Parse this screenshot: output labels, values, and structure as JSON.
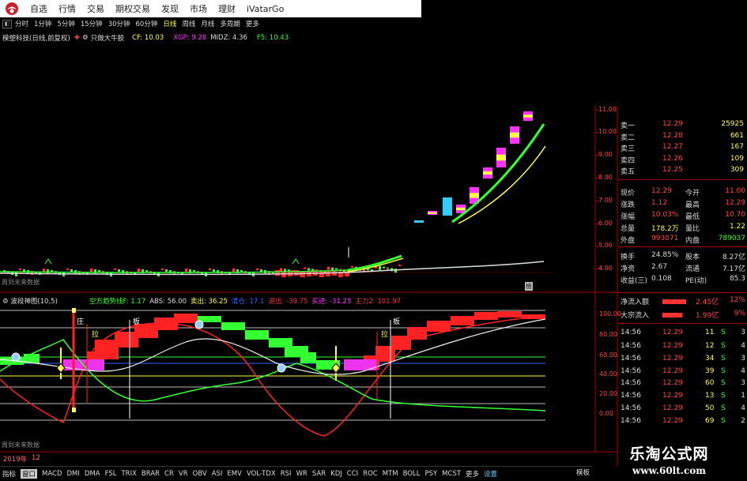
{
  "menu": {
    "items": [
      "自选",
      "行情",
      "交易",
      "期权交易",
      "发现",
      "市场",
      "理财",
      "iVatarGo"
    ]
  },
  "periods": {
    "items": [
      "分时",
      "1分钟",
      "5分钟",
      "15分钟",
      "30分钟",
      "60分钟",
      "日线",
      "周线",
      "月线",
      "多周期",
      "更多"
    ],
    "active": 6
  },
  "info": {
    "stock": "模塑科技(日线,前复权)",
    "tag": "只做大牛股",
    "cf": "CF: 10.03",
    "xgp": "XGP: 9.28",
    "midz": "MIDZ: 4.36",
    "f5": "F5: 10.43"
  },
  "main_chart": {
    "y_ticks": [
      "11.00",
      "10.00",
      "9.00",
      "8.00",
      "7.00",
      "6.00",
      "5.00",
      "4.00"
    ],
    "future_note": "周到未来数据"
  },
  "indicator": {
    "name": "波段神图(10,5)",
    "legend": [
      {
        "text": "空方趋势线F: 1.17",
        "color": "#3f3"
      },
      {
        "text": "ABS: 56.00",
        "color": "#ddd"
      },
      {
        "text": "卖出: 36.25",
        "color": "#ff4"
      },
      {
        "text": "清仓: 17.1",
        "color": "#36f"
      },
      {
        "text": "退出: -39.75",
        "color": "#f33"
      },
      {
        "text": "买进: -31.25",
        "color": "#f3f"
      },
      {
        "text": "主力2: 101.97",
        "color": "#f33"
      }
    ],
    "y_ticks": [
      "100.00",
      "80.00",
      "60.00",
      "40.00",
      "20.00",
      "0.00"
    ],
    "labels": {
      "zhuang": "庄",
      "ban1": "板",
      "la1": "拉",
      "la2": "拉",
      "ban2": "板"
    },
    "future_note": "周到未来数据"
  },
  "date_label": "2019年",
  "date_month": "12",
  "right_panel": {
    "asks": [
      {
        "label": "卖一",
        "price": "12.29",
        "vol": "25925"
      },
      {
        "label": "卖二",
        "price": "12.28",
        "vol": "661"
      },
      {
        "label": "卖三",
        "price": "12.27",
        "vol": "167"
      },
      {
        "label": "卖四",
        "price": "12.26",
        "vol": "109"
      },
      {
        "label": "卖五",
        "price": "12.25",
        "vol": "309"
      }
    ],
    "quote": [
      [
        "现价",
        "12.29",
        "今开",
        "11.00"
      ],
      [
        "涨跌",
        "1.12",
        "最高",
        "12.29"
      ],
      [
        "涨幅",
        "10.03%",
        "最低",
        "10.70"
      ],
      [
        "总量",
        "178.2万",
        "量比",
        "1.22"
      ],
      [
        "外盘",
        "993071",
        "内盘",
        "789037"
      ],
      [
        "换手",
        "24.85%",
        "股本",
        "8.27亿"
      ],
      [
        "净资",
        "2.67",
        "流通",
        "7.17亿"
      ],
      [
        "收益(三)",
        "0.108",
        "PE(动)",
        "85.3"
      ]
    ],
    "flows": [
      {
        "label": "净流入额",
        "value": "2.45亿",
        "pct": "12%"
      },
      {
        "label": "大宗流入",
        "value": "1.99亿",
        "pct": "9%"
      }
    ],
    "ticks": [
      {
        "time": "14:56",
        "price": "12.29",
        "vol": "11",
        "side": "S",
        "n": "3"
      },
      {
        "time": "14:56",
        "price": "12.29",
        "vol": "12",
        "side": "S",
        "n": "4"
      },
      {
        "time": "14:56",
        "price": "12.29",
        "vol": "34",
        "side": "S",
        "n": "3"
      },
      {
        "time": "14:56",
        "price": "12.29",
        "vol": "39",
        "side": "S",
        "n": "4"
      },
      {
        "time": "14:56",
        "price": "12.29",
        "vol": "60",
        "side": "S",
        "n": "3"
      },
      {
        "time": "14:56",
        "price": "12.29",
        "vol": "13",
        "side": "S",
        "n": "1"
      },
      {
        "time": "14:56",
        "price": "12.29",
        "vol": "50",
        "side": "S",
        "n": "4"
      },
      {
        "time": "14:56",
        "price": "12.29",
        "vol": "69",
        "side": "S",
        "n": "2"
      }
    ]
  },
  "bottom": {
    "items": [
      "指标",
      "窗口",
      "MACD",
      "DMI",
      "DMA",
      "FSL",
      "TRIX",
      "BRAR",
      "CR",
      "VR",
      "OBV",
      "ASI",
      "EMV",
      "VOL-TDX",
      "RSI",
      "WR",
      "SAR",
      "KDJ",
      "CCI",
      "ROC",
      "MTM",
      "BOLL",
      "PSY",
      "MCST",
      "更多",
      "设置"
    ],
    "right": "模板"
  },
  "watermark": {
    "line1": "乐淘公式网",
    "line2": "www.60lt.com"
  }
}
